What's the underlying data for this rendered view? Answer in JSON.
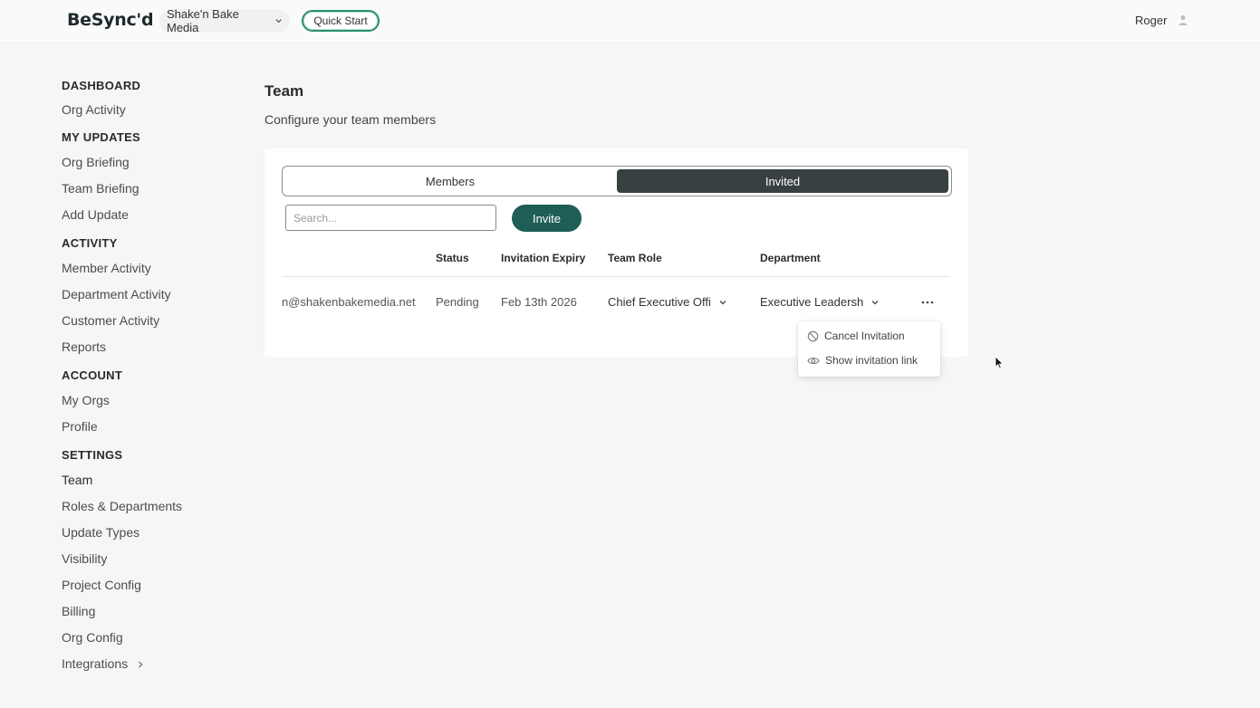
{
  "header": {
    "logo": "BeSync'd",
    "org_name": "Shake'n Bake Media",
    "quick_start": "Quick Start",
    "user_name": "Roger",
    "icons": [
      "chevron-down-icon",
      "user-icon"
    ]
  },
  "sidebar": {
    "sections": [
      {
        "heading": "DASHBOARD",
        "items": [
          "Org Activity"
        ]
      },
      {
        "heading": "MY UPDATES",
        "items": [
          "Org Briefing",
          "Team Briefing",
          "Add Update"
        ]
      },
      {
        "heading": "ACTIVITY",
        "items": [
          "Member Activity",
          "Department Activity",
          "Customer Activity",
          "Reports"
        ]
      },
      {
        "heading": "ACCOUNT",
        "items": [
          "My Orgs",
          "Profile"
        ]
      },
      {
        "heading": "SETTINGS",
        "items": [
          "Team",
          "Roles & Departments",
          "Update Types",
          "Visibility",
          "Project Config",
          "Billing",
          "Org Config",
          "Integrations"
        ]
      }
    ]
  },
  "main": {
    "title": "Team",
    "subtitle": "Configure your team members",
    "tabs": {
      "members": "Members",
      "invited": "Invited",
      "active": "Invited"
    },
    "search": {
      "placeholder": "Search...",
      "value": ""
    },
    "invite_button": "Invite",
    "table": {
      "headers": {
        "status": "Status",
        "expiry": "Invitation Expiry",
        "role": "Team Role",
        "department": "Department"
      },
      "rows": [
        {
          "email": "n@shakenbakemedia.net",
          "status": "Pending",
          "expiry": "Feb 13th 2026",
          "role": "Chief Executive Offi",
          "department": "Executive Leadersh"
        }
      ]
    },
    "row_menu": {
      "cancel": "Cancel Invitation",
      "show_link": "Show invitation link"
    }
  },
  "colors": {
    "accent": "#1f5e56",
    "active_tab": "#394042",
    "quick_start_border": "#2c8f70"
  }
}
